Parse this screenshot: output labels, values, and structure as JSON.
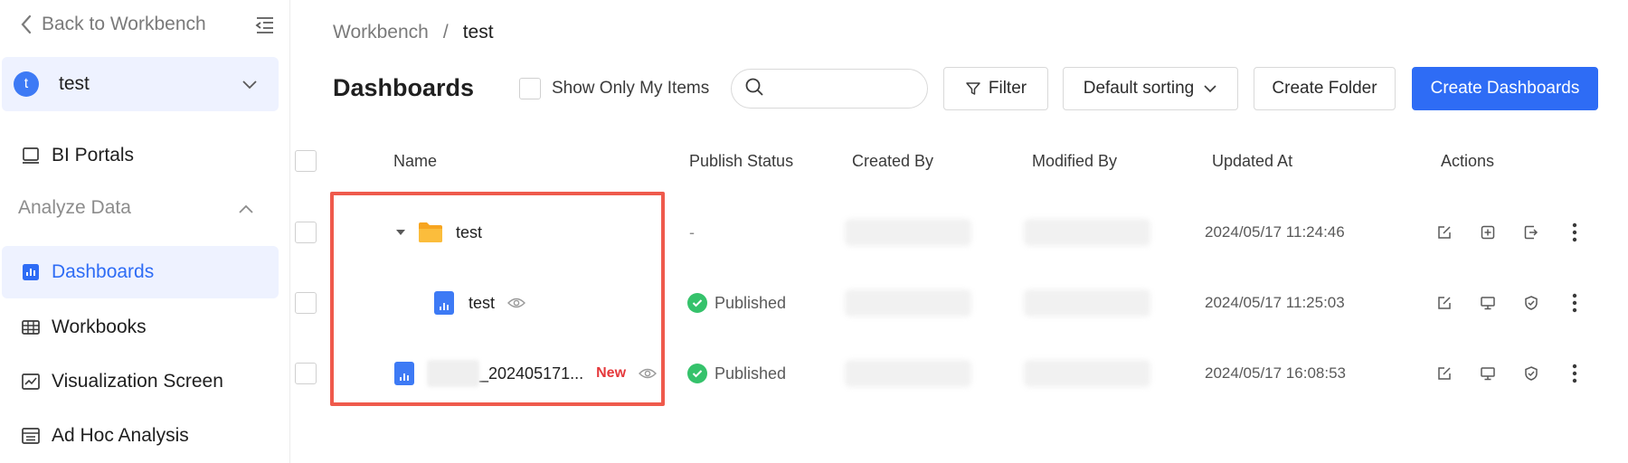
{
  "sidebar": {
    "back_label": "Back to Workbench",
    "workspace": {
      "avatar_letter": "t",
      "name": "test"
    },
    "items": [
      {
        "label": "BI Portals",
        "icon": "monitor-icon"
      },
      {
        "label": "Dashboards",
        "icon": "bar-chart-icon",
        "active": true
      },
      {
        "label": "Workbooks",
        "icon": "table-icon"
      },
      {
        "label": "Visualization Screen",
        "icon": "line-chart-icon"
      },
      {
        "label": "Ad Hoc Analysis",
        "icon": "list-icon"
      }
    ],
    "section_label": "Analyze Data"
  },
  "breadcrumb": {
    "parent": "Workbench",
    "separator": "/",
    "current": "test"
  },
  "page_title": "Dashboards",
  "toolbar": {
    "show_mine_label": "Show Only My Items",
    "search_placeholder": "",
    "filter_label": "Filter",
    "sort_label": "Default sorting",
    "create_folder_label": "Create Folder",
    "create_dashboards_label": "Create Dashboards"
  },
  "table": {
    "columns": [
      "Name",
      "Publish Status",
      "Created By",
      "Modified By",
      "Updated At",
      "Actions"
    ],
    "rows": [
      {
        "type": "folder",
        "name": "test",
        "status": "-",
        "updated_at": "2024/05/17 11:24:46"
      },
      {
        "type": "dashboard",
        "name": "test",
        "status": "Published",
        "updated_at": "2024/05/17 11:25:03"
      },
      {
        "type": "dashboard",
        "name": "_202405171...",
        "badge": "New",
        "status": "Published",
        "updated_at": "2024/05/17 16:08:53"
      }
    ]
  },
  "colors": {
    "accent": "#2e6cf5",
    "highlight": "#ef5a4c",
    "success": "#35c26b",
    "folder": "#f7a520",
    "new_badge": "#e5383b"
  }
}
